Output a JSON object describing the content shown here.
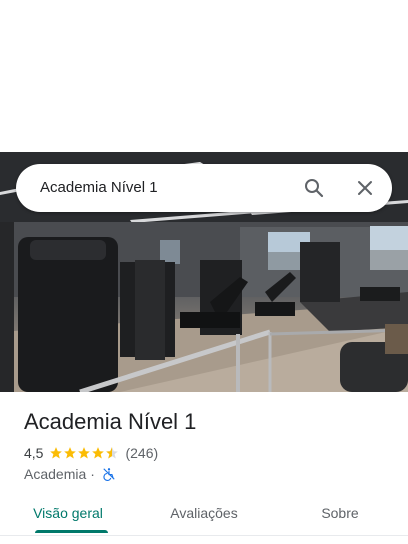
{
  "search": {
    "query": "Academia Nível 1",
    "search_icon": "search-icon",
    "close_icon": "close-icon"
  },
  "photo": {
    "subject": "gym-interior-photo"
  },
  "place": {
    "name": "Academia Nível 1",
    "rating": "4,5",
    "rating_value": 4.5,
    "reviews": "(246)",
    "category": "Academia",
    "separator": "·",
    "accessibility_icon": "no-wheelchair-access-icon"
  },
  "tabs": [
    {
      "label": "Visão geral",
      "active": true
    },
    {
      "label": "Avaliações",
      "active": false
    },
    {
      "label": "Sobre",
      "active": false
    }
  ],
  "colors": {
    "accent": "#00796b",
    "star": "#fbbc04",
    "access_icon": "#1a73e8",
    "text_primary": "#202124",
    "text_secondary": "#5f6368"
  }
}
